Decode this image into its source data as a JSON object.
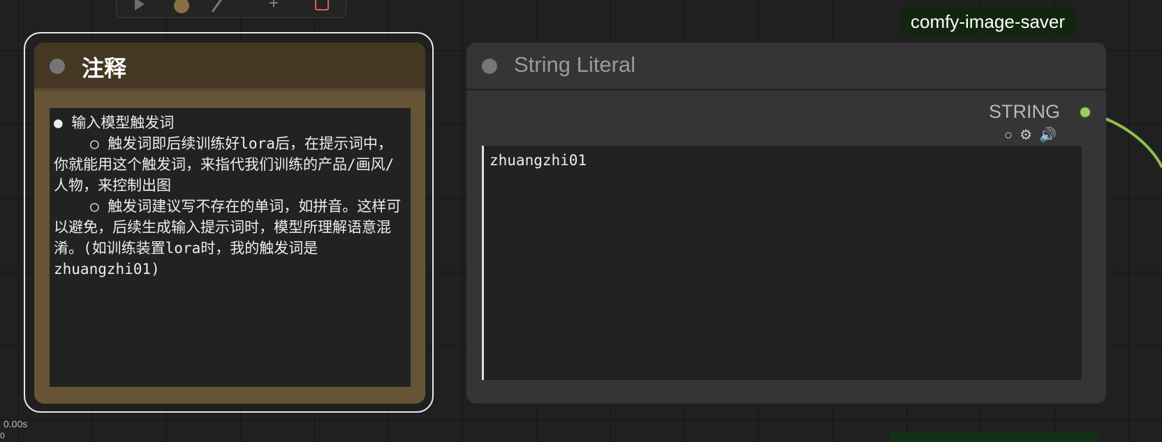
{
  "toolbar": {
    "icons": [
      "play-icon",
      "record-dot-icon",
      "link-icon",
      "add-icon",
      "delete-icon"
    ]
  },
  "badge": {
    "label": "comfy-image-saver",
    "color": "#12260f"
  },
  "note_node": {
    "title": "注释",
    "color": "#665437",
    "header_color": "#443825",
    "lines": [
      "● 输入模型触发词",
      "○ 触发词即后续训练好lora后，在提示词中，你就能用这个触发词，来指代我们训练的产品/画风/人物，来控制出图",
      "○ 触发词建议写不存在的单词，如拼音。这样可以避免，后续生成输入提示词时，模型所理解语意混淆。(如训练装置lora时，我的触发词是zhuangzhi01)"
    ]
  },
  "string_node": {
    "title": "String Literal",
    "output_label": "STRING",
    "output_color": "#9bcf58",
    "icons": [
      "circle-icon",
      "gear-icon",
      "speaker-icon"
    ],
    "value": "zhuangzhi01"
  },
  "status": {
    "timer": "0.00s",
    "extra": "0"
  }
}
